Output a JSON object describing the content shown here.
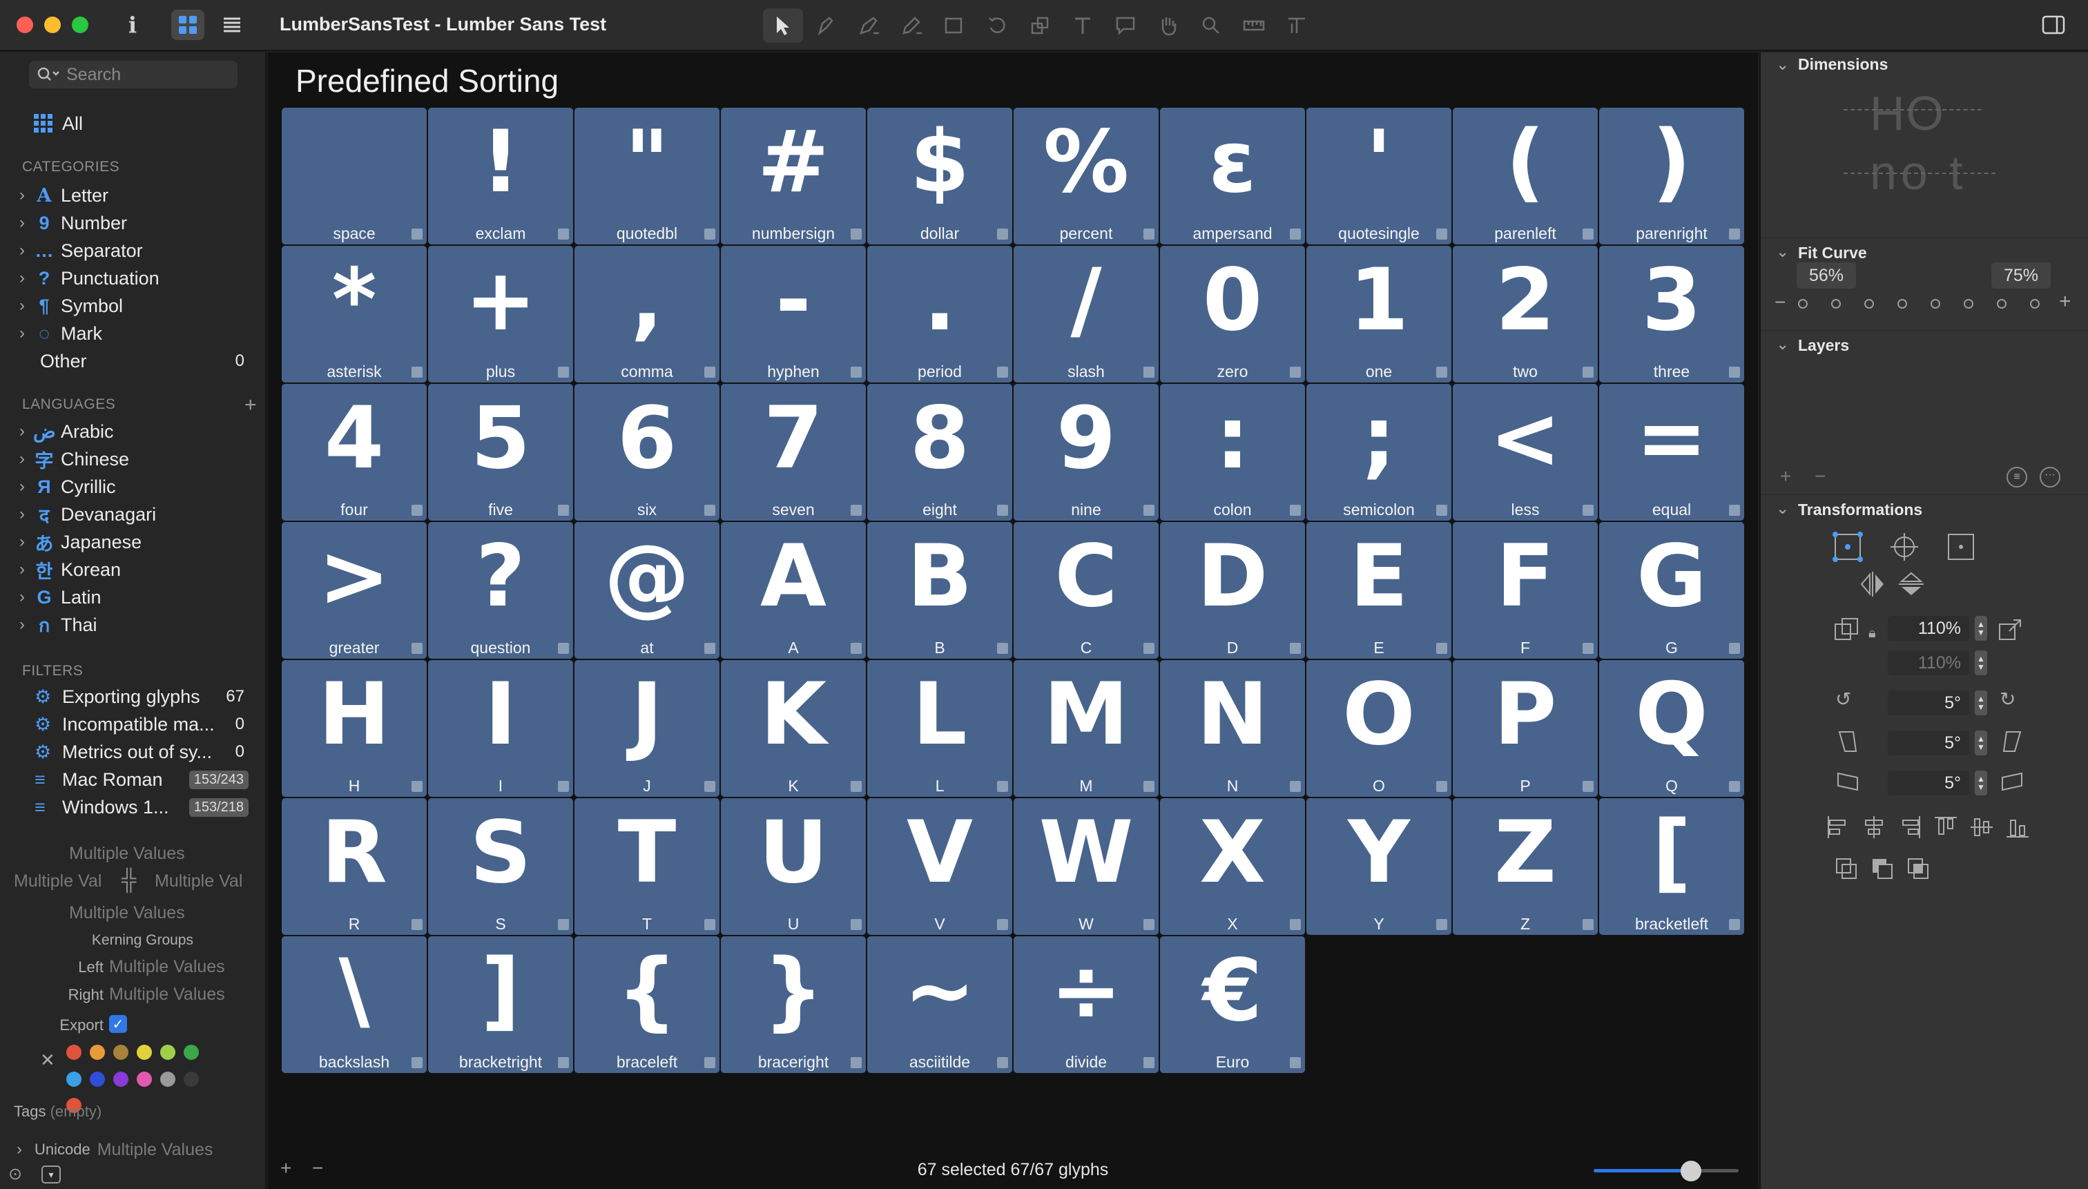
{
  "window": {
    "title": "LumberSansTest - Lumber Sans Test"
  },
  "toolbar": {
    "tools": [
      "select-tool",
      "draw-tool",
      "pen-tool",
      "pencil-tool",
      "primitives-tool",
      "rotate-tool",
      "scale-tool",
      "text-tool",
      "annotation-tool",
      "hand-tool",
      "zoom-tool",
      "measurement-tool",
      "glyph-tool"
    ]
  },
  "sidebar": {
    "search_placeholder": "Search",
    "all_label": "All",
    "categories_heading": "CATEGORIES",
    "categories": [
      {
        "icon": "A",
        "label": "Letter"
      },
      {
        "icon": "9",
        "label": "Number"
      },
      {
        "icon": "…",
        "label": "Separator"
      },
      {
        "icon": "?",
        "label": "Punctuation"
      },
      {
        "icon": "¶",
        "label": "Symbol"
      },
      {
        "icon": "◌",
        "label": "Mark"
      }
    ],
    "other": {
      "label": "Other",
      "count": "0"
    },
    "languages_heading": "LANGUAGES",
    "languages": [
      {
        "icon": "ض",
        "label": "Arabic"
      },
      {
        "icon": "字",
        "label": "Chinese"
      },
      {
        "icon": "Я",
        "label": "Cyrillic"
      },
      {
        "icon": "द",
        "label": "Devanagari"
      },
      {
        "icon": "あ",
        "label": "Japanese"
      },
      {
        "icon": "한",
        "label": "Korean"
      },
      {
        "icon": "G",
        "label": "Latin"
      },
      {
        "icon": "ก",
        "label": "Thai"
      }
    ],
    "filters_heading": "FILTERS",
    "filters": [
      {
        "type": "gear",
        "label": "Exporting glyphs",
        "count": "67"
      },
      {
        "type": "gear",
        "label": "Incompatible ma...",
        "count": "0"
      },
      {
        "type": "gear",
        "label": "Metrics out of sy...",
        "count": "0"
      },
      {
        "type": "list",
        "label": "Mac Roman",
        "pill": "153/243"
      },
      {
        "type": "list",
        "label": "Windows 1...",
        "pill": "153/218"
      }
    ]
  },
  "properties": {
    "multiple": "Multiple Values",
    "multiple_short": "Multiple Val",
    "kerning_groups": "Kerning Groups",
    "left_label": "Left",
    "right_label": "Right",
    "export_label": "Export",
    "tags_label": "Tags",
    "tags_value": "(empty)",
    "unicode_label": "Unicode",
    "colors": [
      "#e0533a",
      "#e89b3a",
      "#a8823a",
      "#e0d23a",
      "#a0d04a",
      "#3aa84a",
      "#3aa0e8",
      "#2f4fd8",
      "#8a3ad8",
      "#e05ab0",
      "#9a9a9a",
      "#3a3a3a"
    ]
  },
  "main": {
    "heading": "Predefined Sorting",
    "glyphs": [
      {
        "g": " ",
        "n": "space"
      },
      {
        "g": "!",
        "n": "exclam"
      },
      {
        "g": "\"",
        "n": "quotedbl"
      },
      {
        "g": "#",
        "n": "numbersign"
      },
      {
        "g": "$",
        "n": "dollar"
      },
      {
        "g": "%",
        "n": "percent"
      },
      {
        "g": "ɛ",
        "n": "ampersand"
      },
      {
        "g": "'",
        "n": "quotesingle"
      },
      {
        "g": "(",
        "n": "parenleft"
      },
      {
        "g": ")",
        "n": "parenright"
      },
      {
        "g": "*",
        "n": "asterisk"
      },
      {
        "g": "+",
        "n": "plus"
      },
      {
        "g": ",",
        "n": "comma"
      },
      {
        "g": "-",
        "n": "hyphen"
      },
      {
        "g": ".",
        "n": "period"
      },
      {
        "g": "/",
        "n": "slash"
      },
      {
        "g": "0",
        "n": "zero"
      },
      {
        "g": "1",
        "n": "one"
      },
      {
        "g": "2",
        "n": "two"
      },
      {
        "g": "3",
        "n": "three"
      },
      {
        "g": "4",
        "n": "four"
      },
      {
        "g": "5",
        "n": "five"
      },
      {
        "g": "6",
        "n": "six"
      },
      {
        "g": "7",
        "n": "seven"
      },
      {
        "g": "8",
        "n": "eight"
      },
      {
        "g": "9",
        "n": "nine"
      },
      {
        "g": ":",
        "n": "colon"
      },
      {
        "g": ";",
        "n": "semicolon"
      },
      {
        "g": "<",
        "n": "less"
      },
      {
        "g": "=",
        "n": "equal"
      },
      {
        "g": ">",
        "n": "greater"
      },
      {
        "g": "?",
        "n": "question"
      },
      {
        "g": "@",
        "n": "at"
      },
      {
        "g": "A",
        "n": "A"
      },
      {
        "g": "B",
        "n": "B"
      },
      {
        "g": "C",
        "n": "C"
      },
      {
        "g": "D",
        "n": "D"
      },
      {
        "g": "E",
        "n": "E"
      },
      {
        "g": "F",
        "n": "F"
      },
      {
        "g": "G",
        "n": "G"
      },
      {
        "g": "H",
        "n": "H"
      },
      {
        "g": "I",
        "n": "I"
      },
      {
        "g": "J",
        "n": "J"
      },
      {
        "g": "K",
        "n": "K"
      },
      {
        "g": "L",
        "n": "L"
      },
      {
        "g": "M",
        "n": "M"
      },
      {
        "g": "N",
        "n": "N"
      },
      {
        "g": "O",
        "n": "O"
      },
      {
        "g": "P",
        "n": "P"
      },
      {
        "g": "Q",
        "n": "Q"
      },
      {
        "g": "R",
        "n": "R"
      },
      {
        "g": "S",
        "n": "S"
      },
      {
        "g": "T",
        "n": "T"
      },
      {
        "g": "U",
        "n": "U"
      },
      {
        "g": "V",
        "n": "V"
      },
      {
        "g": "W",
        "n": "W"
      },
      {
        "g": "X",
        "n": "X"
      },
      {
        "g": "Y",
        "n": "Y"
      },
      {
        "g": "Z",
        "n": "Z"
      },
      {
        "g": "[",
        "n": "bracketleft"
      },
      {
        "g": "\\",
        "n": "backslash"
      },
      {
        "g": "]",
        "n": "bracketright"
      },
      {
        "g": "{",
        "n": "braceleft"
      },
      {
        "g": "}",
        "n": "braceright"
      },
      {
        "g": "~",
        "n": "asciitilde"
      },
      {
        "g": "÷",
        "n": "divide"
      },
      {
        "g": "€",
        "n": "Euro"
      }
    ],
    "status": "67 selected 67/67 glyphs",
    "zoom_fraction": 0.67
  },
  "inspector": {
    "dimensions_label": "Dimensions",
    "dimensions_preview_top": "HO",
    "dimensions_preview_bottom": "no t",
    "fit_curve_label": "Fit Curve",
    "fit_left": "56%",
    "fit_right": "75%",
    "layers_label": "Layers",
    "transformations_label": "Transformations",
    "scale_x": "110%",
    "scale_y": "110%",
    "rotate": "5°",
    "slant_x": "5°",
    "slant_y": "5°",
    "colors": {
      "accent": "#2f78e6",
      "glyph_cell": "#48648d",
      "category_icon": "#4d9cf6"
    }
  }
}
